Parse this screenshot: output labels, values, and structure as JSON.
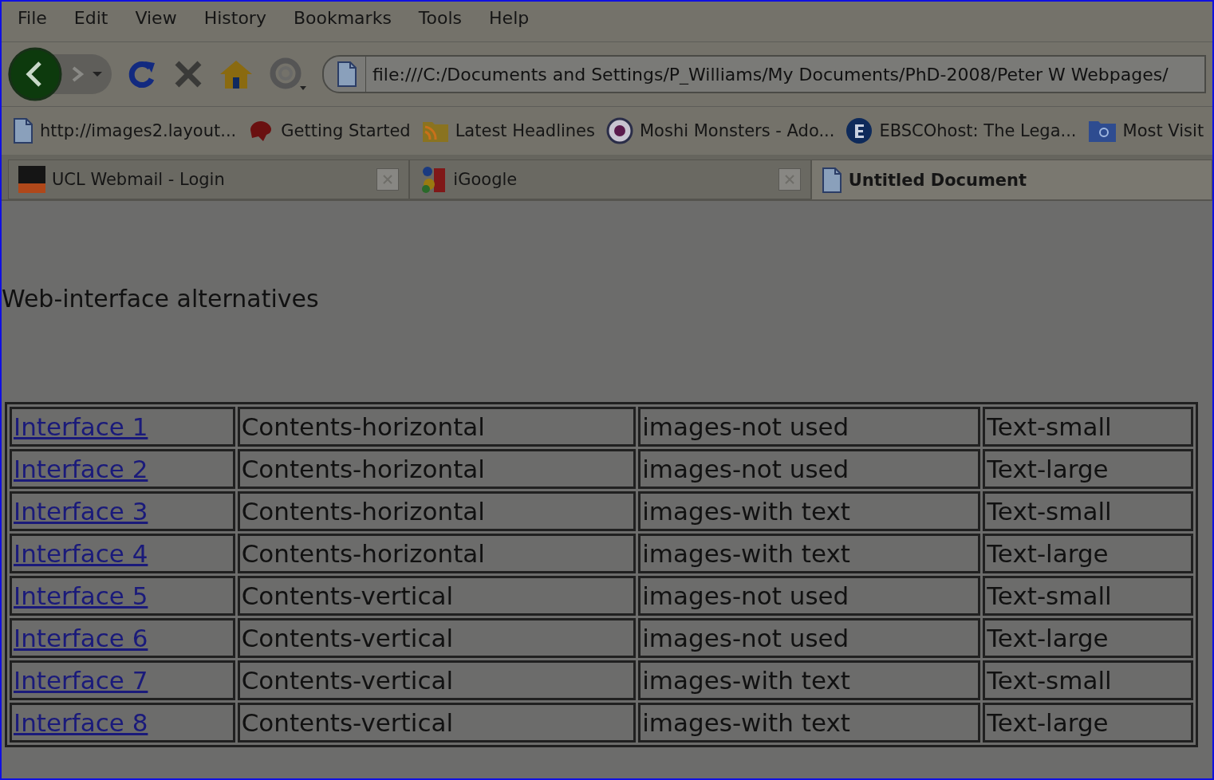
{
  "menu": [
    "File",
    "Edit",
    "View",
    "History",
    "Bookmarks",
    "Tools",
    "Help"
  ],
  "address": {
    "value": "file:///C:/Documents and Settings/P_Williams/My Documents/PhD-2008/Peter W Webpages/"
  },
  "bookmarks": [
    {
      "label": "http://images2.layout...",
      "kind": "page"
    },
    {
      "label": "Getting Started",
      "kind": "start"
    },
    {
      "label": "Latest Headlines",
      "kind": "feed"
    },
    {
      "label": "Moshi Monsters - Ado...",
      "kind": "moshi"
    },
    {
      "label": "EBSCOhost: The Lega...",
      "kind": "ebsco"
    },
    {
      "label": "Most Visit",
      "kind": "folder"
    }
  ],
  "tabs": [
    {
      "label": "UCL Webmail - Login",
      "kind": "ucl",
      "selected": false
    },
    {
      "label": "iGoogle",
      "kind": "google",
      "selected": false
    },
    {
      "label": "Untitled Document",
      "kind": "page",
      "selected": true
    }
  ],
  "heading": "Web-interface alternatives",
  "table": {
    "rows": [
      [
        "Interface 1",
        "Contents-horizontal",
        "images-not used",
        "Text-small"
      ],
      [
        "Interface 2",
        "Contents-horizontal",
        "images-not used",
        "Text-large"
      ],
      [
        "Interface 3",
        "Contents-horizontal",
        "images-with text",
        "Text-small"
      ],
      [
        "Interface 4",
        "Contents-horizontal",
        "images-with text",
        "Text-large"
      ],
      [
        "Interface 5",
        "Contents-vertical",
        "images-not used",
        "Text-small"
      ],
      [
        "Interface 6",
        "Contents-vertical",
        "images-not used",
        "Text-large"
      ],
      [
        "Interface 7",
        "Contents-vertical",
        "images-with text",
        "Text-small"
      ],
      [
        "Interface 8",
        "Contents-vertical",
        "images-with text",
        "Text-large"
      ]
    ]
  }
}
